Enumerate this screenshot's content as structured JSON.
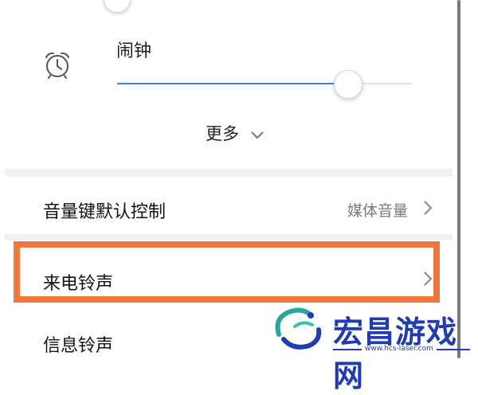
{
  "alarm": {
    "label": "闹钟",
    "icon": "alarm-clock-icon",
    "volume_level": 0.78
  },
  "more": {
    "label": "更多",
    "icon": "chevron-down-icon"
  },
  "settings": {
    "volume_key": {
      "label": "音量键默认控制",
      "value": "媒体音量",
      "icon": "chevron-right-icon"
    },
    "ringtone": {
      "label": "来电铃声",
      "icon": "chevron-right-icon"
    },
    "message_tone": {
      "label": "信息铃声"
    }
  },
  "colors": {
    "accent": "#3f7de0",
    "highlight_box": "#f07640",
    "watermark": "#1f3db0"
  },
  "watermark": {
    "title": "宏昌游戏网",
    "url": "www.hcs-laser.com",
    "icon": "dragon-logo-icon"
  }
}
